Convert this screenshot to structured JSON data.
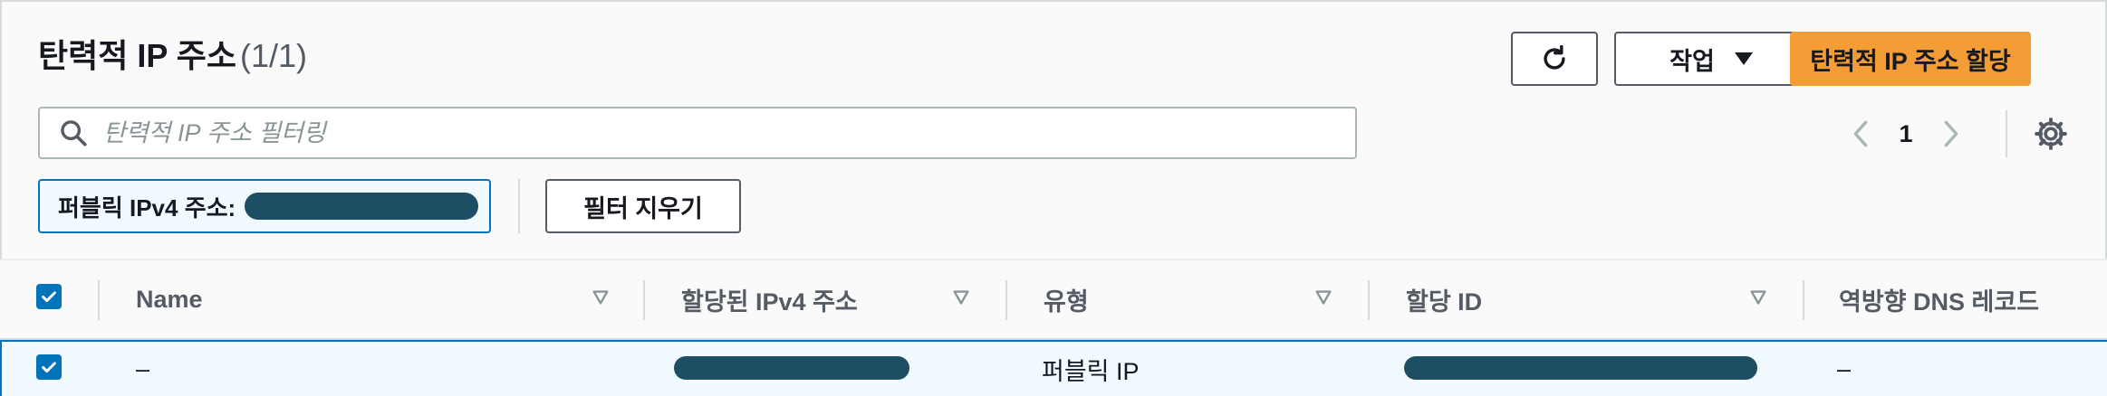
{
  "header": {
    "title": "탄력적 IP 주소",
    "count": "(1/1)"
  },
  "toolbar": {
    "actions_label": "작업",
    "allocate_label": "탄력적 IP 주소 할당"
  },
  "search": {
    "placeholder": "탄력적 IP 주소 필터링",
    "value": ""
  },
  "pagination": {
    "current_page": "1"
  },
  "filter_token": {
    "label": "퍼블릭 IPv4 주소:"
  },
  "clear_filters_label": "필터 지우기",
  "table": {
    "columns": [
      "Name",
      "할당된 IPv4 주소",
      "유형",
      "할당 ID",
      "역방향 DNS 레코드"
    ],
    "rows": [
      {
        "name": "–",
        "type": "퍼블릭 IP",
        "reverse_dns": "–"
      }
    ]
  },
  "colors": {
    "accent": "#0073bb",
    "primary_button": "#f49d37",
    "redaction": "#1d4e63"
  }
}
